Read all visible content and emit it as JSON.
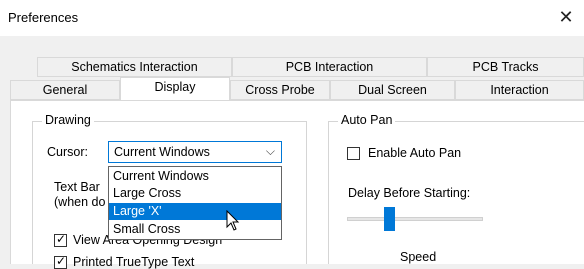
{
  "window": {
    "title": "Preferences",
    "close_icon": "close-icon"
  },
  "tabs": {
    "row_back": [
      {
        "label": "Schematics Interaction"
      },
      {
        "label": "PCB Interaction"
      },
      {
        "label": "PCB Tracks"
      }
    ],
    "row_front": [
      {
        "label": "General"
      },
      {
        "label": "Display",
        "active": true
      },
      {
        "label": "Cross Probe"
      },
      {
        "label": "Dual Screen"
      },
      {
        "label": "Interaction"
      }
    ]
  },
  "drawing": {
    "title": "Drawing",
    "cursor_label": "Cursor:",
    "cursor_value": "Current Windows",
    "options": [
      "Current Windows",
      "Large Cross",
      "Large 'X'",
      "Small Cross"
    ],
    "highlighted_option": "Large 'X'",
    "text_bar_line1": "Text Bar",
    "text_bar_line2": "(when do",
    "view_label": "View Area Opening Design",
    "view_checked": true,
    "printed_label": "Printed TrueType Text",
    "printed_checked": true
  },
  "auto_pan": {
    "title": "Auto Pan",
    "enable_label": "Enable Auto Pan",
    "enable_checked": false,
    "delay_label": "Delay Before Starting:",
    "delay_level": 0.28,
    "speed_label": "Speed"
  }
}
